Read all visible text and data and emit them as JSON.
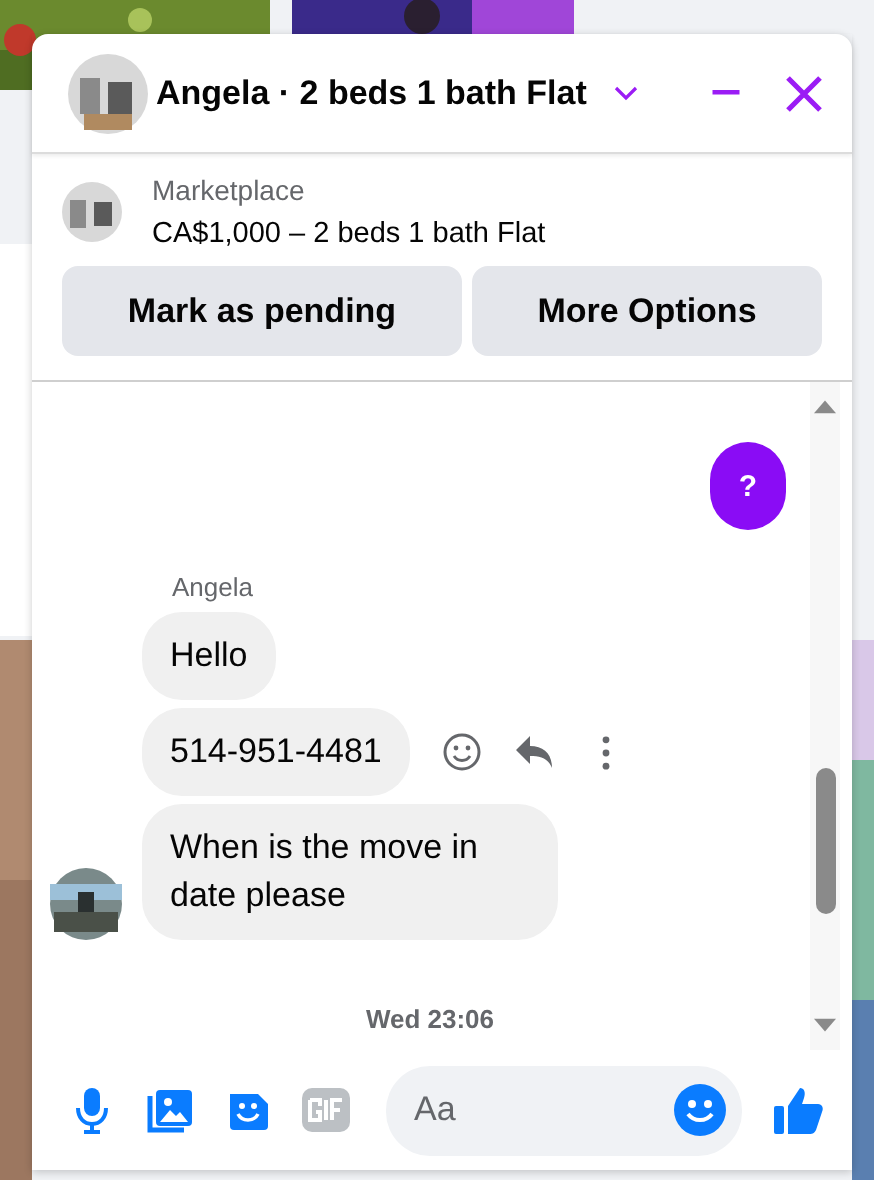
{
  "chat": {
    "title": "Angela · 2 beds 1 bath Flat",
    "listing": {
      "source": "Marketplace",
      "title": "CA$1,000 – 2 beds 1 bath Flat"
    },
    "actions": [
      "Mark as pending",
      "More Options"
    ],
    "messages": [
      {
        "kind": "outgoing",
        "text": "?"
      },
      {
        "kind": "sender",
        "text": "Angela"
      },
      {
        "kind": "incoming",
        "text": "Hello",
        "hovered": false,
        "avatar": false
      },
      {
        "kind": "incoming",
        "text": "514-951-4481",
        "hovered": true,
        "avatar": false
      },
      {
        "kind": "incoming",
        "text": "When is the move in date please",
        "hovered": false,
        "avatar": true
      },
      {
        "kind": "time",
        "text": "Wed 23:06"
      }
    ],
    "composer": {
      "placeholder": "Aa"
    }
  }
}
